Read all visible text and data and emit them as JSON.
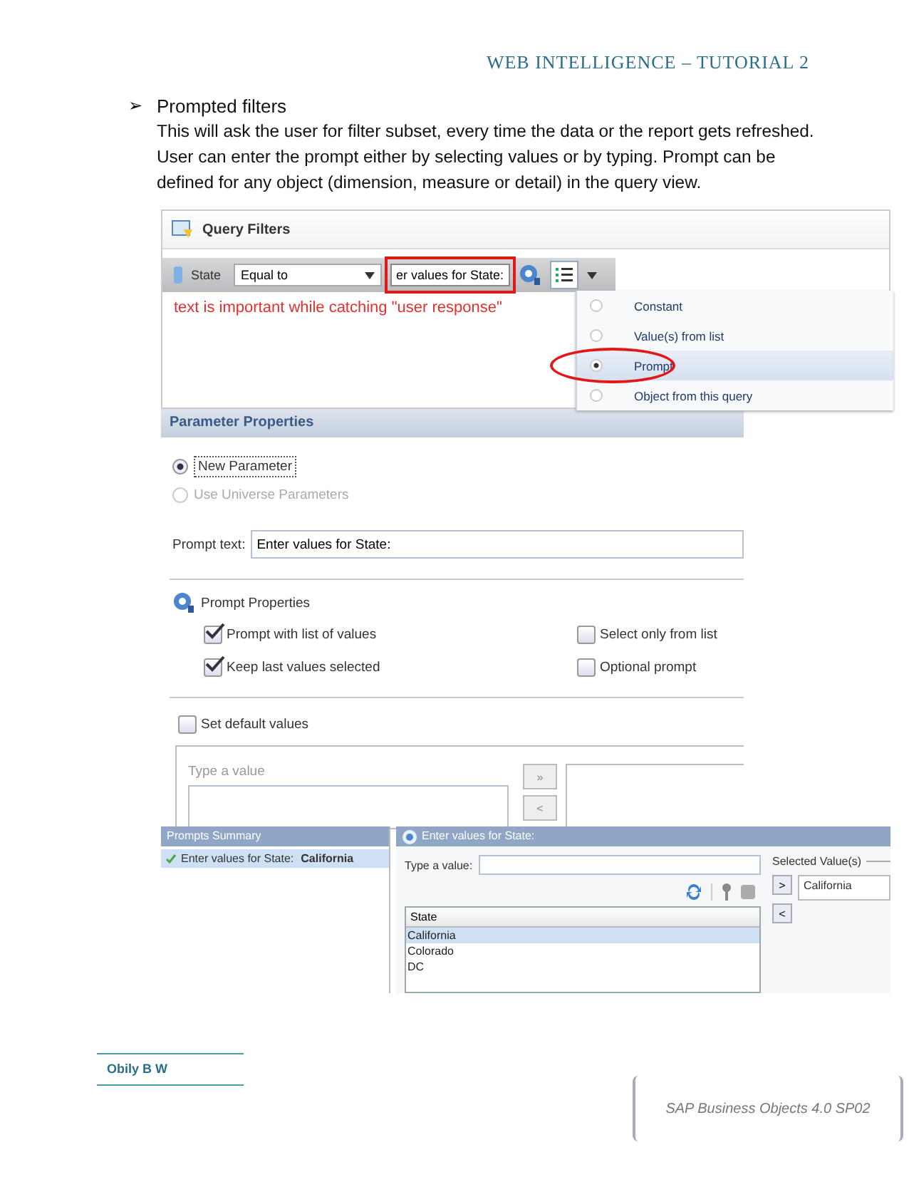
{
  "header": {
    "title": "WEB INTELLIGENCE – TUTORIAL 2"
  },
  "section": {
    "bullet": "➢",
    "heading": "Prompted filters",
    "body": "This will ask the user for filter subset, every time the data or the report gets refreshed. User can enter the prompt either by selecting values or by typing. Prompt can be defined for any object (dimension, measure or detail) in the query view."
  },
  "query_filters": {
    "title": "Query Filters",
    "object": "State",
    "operator": "Equal to",
    "value": "er values for State:",
    "annotation": "text is important while catching \"user response\"",
    "menu": [
      {
        "label": "Constant",
        "selected": false
      },
      {
        "label": "Value(s) from list",
        "selected": false
      },
      {
        "label": "Prompt",
        "selected": true
      },
      {
        "label": "Object from this query",
        "selected": false
      }
    ]
  },
  "parameter_properties": {
    "title": "Parameter Properties",
    "parameter_options": [
      {
        "label": "New Parameter",
        "selected": true,
        "disabled": false
      },
      {
        "label": "Use Universe Parameters",
        "selected": false,
        "disabled": true
      }
    ],
    "prompt_text_label": "Prompt text:",
    "prompt_text": "Enter values for State:",
    "prompt_properties_title": "Prompt Properties",
    "options": [
      {
        "label": "Prompt with list of values",
        "checked": true
      },
      {
        "label": "Select only from list",
        "checked": false
      },
      {
        "label": "Keep last values selected",
        "checked": true
      },
      {
        "label": "Optional prompt",
        "checked": false
      }
    ],
    "set_default": {
      "label": "Set default values",
      "checked": false
    },
    "type_value_placeholder": "Type a value",
    "add_button": "»",
    "remove_button": "<"
  },
  "prompts": {
    "summary_title": "Prompts Summary",
    "summary_items": [
      {
        "label": "Enter values for State:",
        "value": "California",
        "selected": true
      }
    ],
    "panel_title": "Enter values for State:",
    "type_value_label": "Type a value:",
    "list_column": "State",
    "list_items": [
      {
        "label": "California",
        "selected": true
      },
      {
        "label": "Colorado",
        "selected": false
      },
      {
        "label": "DC",
        "selected": false
      }
    ],
    "selected_title": "Selected Value(s)",
    "add_button": ">",
    "remove_button": "<",
    "selected_values": [
      "California"
    ]
  },
  "footer": {
    "author": "Obily B W",
    "product": "SAP Business Objects 4.0 SP02"
  }
}
